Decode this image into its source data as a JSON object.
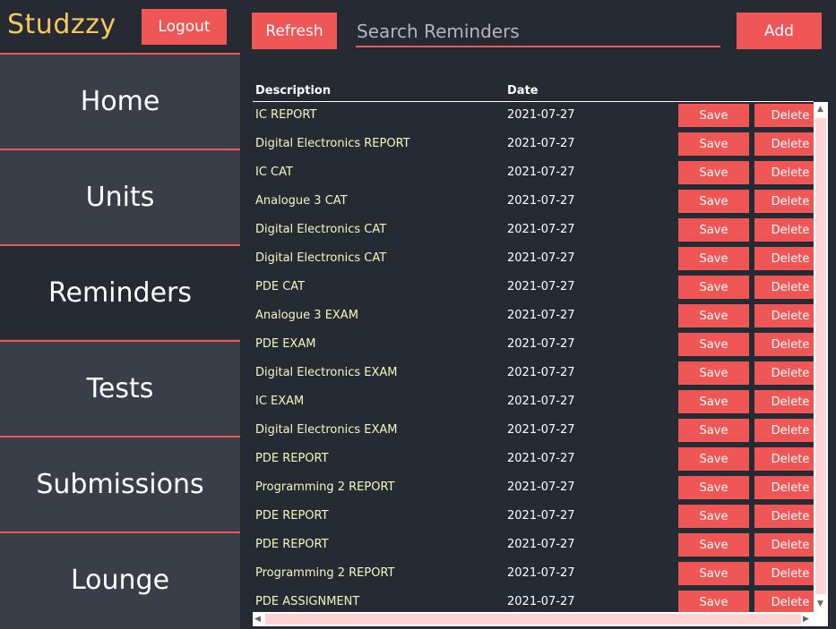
{
  "app": {
    "brand": "Studzzy",
    "logout_label": "Logout"
  },
  "sidebar": {
    "items": [
      {
        "label": "Home",
        "active": false
      },
      {
        "label": "Units",
        "active": false
      },
      {
        "label": "Reminders",
        "active": true
      },
      {
        "label": "Tests",
        "active": false
      },
      {
        "label": "Submissions",
        "active": false
      },
      {
        "label": "Lounge",
        "active": false
      }
    ]
  },
  "toolbar": {
    "refresh_label": "Refresh",
    "search_placeholder": "Search Reminders",
    "search_value": "",
    "add_label": "Add"
  },
  "table": {
    "columns": [
      "Description",
      "Date"
    ],
    "save_label": "Save",
    "delete_label": "Delete",
    "rows": [
      {
        "description": "IC REPORT",
        "date": "2021-07-27"
      },
      {
        "description": "Digital Electronics REPORT",
        "date": "2021-07-27"
      },
      {
        "description": "IC CAT",
        "date": "2021-07-27"
      },
      {
        "description": "Analogue 3 CAT",
        "date": "2021-07-27"
      },
      {
        "description": "Digital Electronics CAT",
        "date": "2021-07-27"
      },
      {
        "description": "Digital Electronics CAT",
        "date": "2021-07-27"
      },
      {
        "description": "PDE CAT",
        "date": "2021-07-27"
      },
      {
        "description": "Analogue 3 EXAM",
        "date": "2021-07-27"
      },
      {
        "description": "PDE EXAM",
        "date": "2021-07-27"
      },
      {
        "description": "Digital Electronics EXAM",
        "date": "2021-07-27"
      },
      {
        "description": "IC EXAM",
        "date": "2021-07-27"
      },
      {
        "description": "Digital Electronics EXAM",
        "date": "2021-07-27"
      },
      {
        "description": "PDE REPORT",
        "date": "2021-07-27"
      },
      {
        "description": "Programming 2 REPORT",
        "date": "2021-07-27"
      },
      {
        "description": "PDE REPORT",
        "date": "2021-07-27"
      },
      {
        "description": "PDE REPORT",
        "date": "2021-07-27"
      },
      {
        "description": "Programming 2 REPORT",
        "date": "2021-07-27"
      },
      {
        "description": "PDE ASSIGNMENT",
        "date": "2021-07-27"
      }
    ]
  },
  "colors": {
    "accent": "#ef5656",
    "background": "#262a33",
    "sidebar": "#3a3e48",
    "brand": "#f5c85c",
    "description_text": "#f3f7c0"
  },
  "icons": {
    "scroll_up": "scroll-up-arrow-icon",
    "scroll_down": "scroll-down-arrow-icon",
    "scroll_left": "scroll-left-arrow-icon",
    "scroll_right": "scroll-right-arrow-icon"
  }
}
